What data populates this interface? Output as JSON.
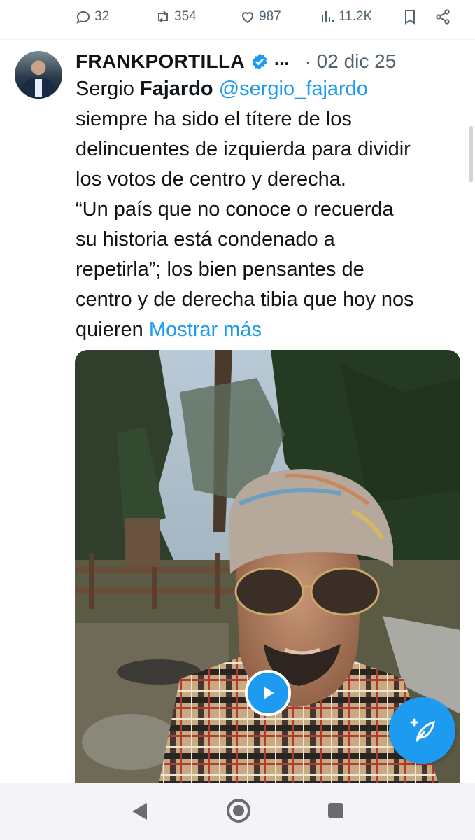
{
  "actions": {
    "replies": "32",
    "reposts": "354",
    "likes": "987",
    "views": "11.2K"
  },
  "tweet": {
    "author": "FRANKPORTILLA",
    "more": "...",
    "date": "· 02 dic 25",
    "text_parts": {
      "name_first": "Sergio ",
      "name_bold": "Fajardo",
      "handle": "@sergio_fajardo",
      "line1": "siempre ha sido el títere de los",
      "line2": "delincuentes de  izquierda para dividir",
      "line3": "los votos de centro y derecha.",
      "line4": "“Un país que no conoce o recuerda",
      "line5": "su historia está condenado a",
      "line6": "repetirla”; los bien pensantes de",
      "line7": "centro y de derecha tibia que hoy nos",
      "line8": "quieren ",
      "show_more": "Mostrar más"
    }
  },
  "colors": {
    "accent": "#1d9bf0",
    "text": "#0f1419",
    "muted": "#536471"
  },
  "icons": [
    "reply-icon",
    "repost-icon",
    "like-icon",
    "views-icon",
    "bookmark-icon",
    "share-icon",
    "verified-icon",
    "play-icon",
    "compose-icon",
    "nav-back-icon",
    "nav-home-icon",
    "nav-recents-icon"
  ]
}
